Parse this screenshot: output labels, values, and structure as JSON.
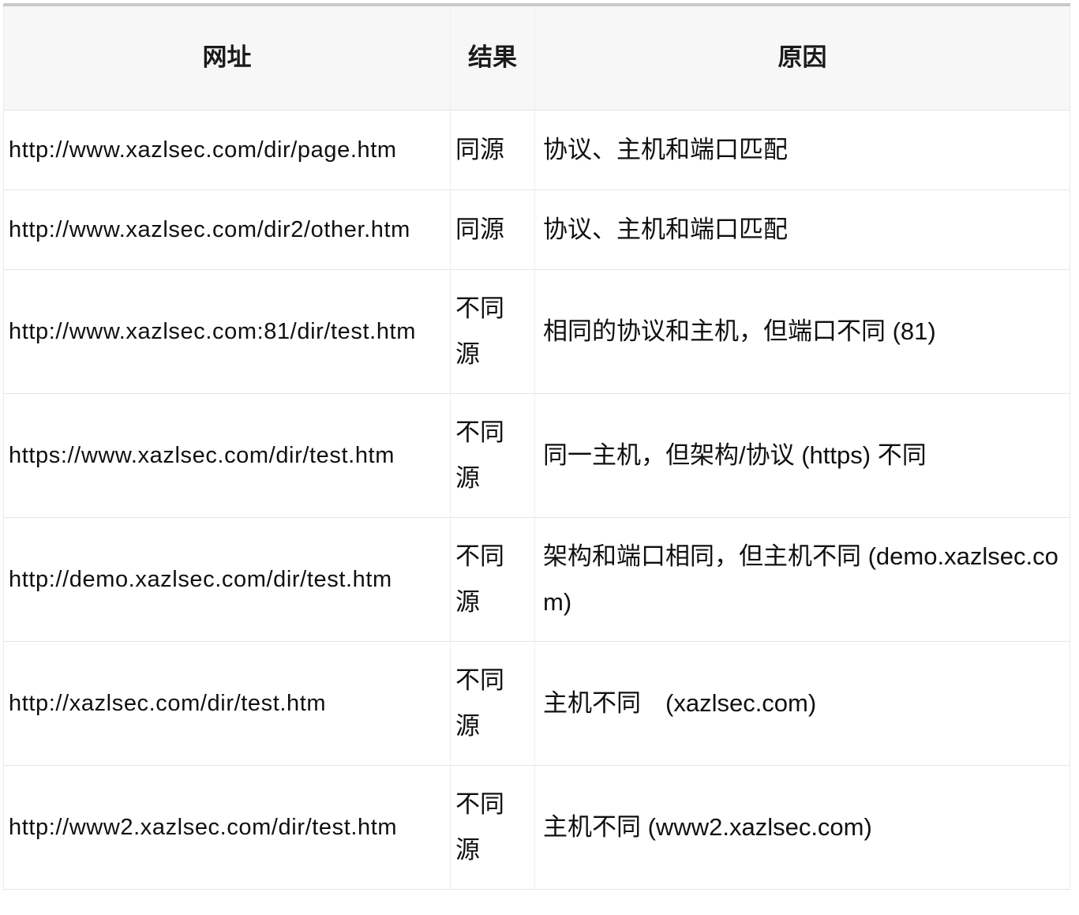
{
  "table": {
    "columns": [
      {
        "key": "url",
        "label": "网址"
      },
      {
        "key": "result",
        "label": "结果"
      },
      {
        "key": "reason",
        "label": "原因"
      }
    ],
    "rows": [
      {
        "url": "http://www.xazlsec.com/dir/page.htm",
        "result": "同源",
        "reason": "协议、主机和端口匹配"
      },
      {
        "url": "http://www.xazlsec.com/dir2/other.htm",
        "result": "同源",
        "reason": "协议、主机和端口匹配"
      },
      {
        "url": "http://www.xazlsec.com:81/dir/test.htm",
        "result": "不同源",
        "reason": "相同的协议和主机，但端口不同 (81)"
      },
      {
        "url": "https://www.xazlsec.com/dir/test.htm",
        "result": "不同源",
        "reason": "同一主机，但架构/协议 (https) 不同"
      },
      {
        "url": "http://demo.xazlsec.com/dir/test.htm",
        "result": "不同源",
        "reason": "架构和端口相同，但主机不同 (demo.xazlsec.com)"
      },
      {
        "url": "http://xazlsec.com/dir/test.htm",
        "result": "不同源",
        "reason": "主机不同　(xazlsec.com)"
      },
      {
        "url": "http://www2.xazlsec.com/dir/test.htm",
        "result": "不同源",
        "reason": "主机不同 (www2.xazlsec.com)"
      }
    ]
  },
  "colors": {
    "header_background": "#f7f7f7",
    "top_border": "#c9c9c9",
    "cell_border": "#ededed",
    "text": "#101010",
    "page_background": "#ffffff"
  }
}
